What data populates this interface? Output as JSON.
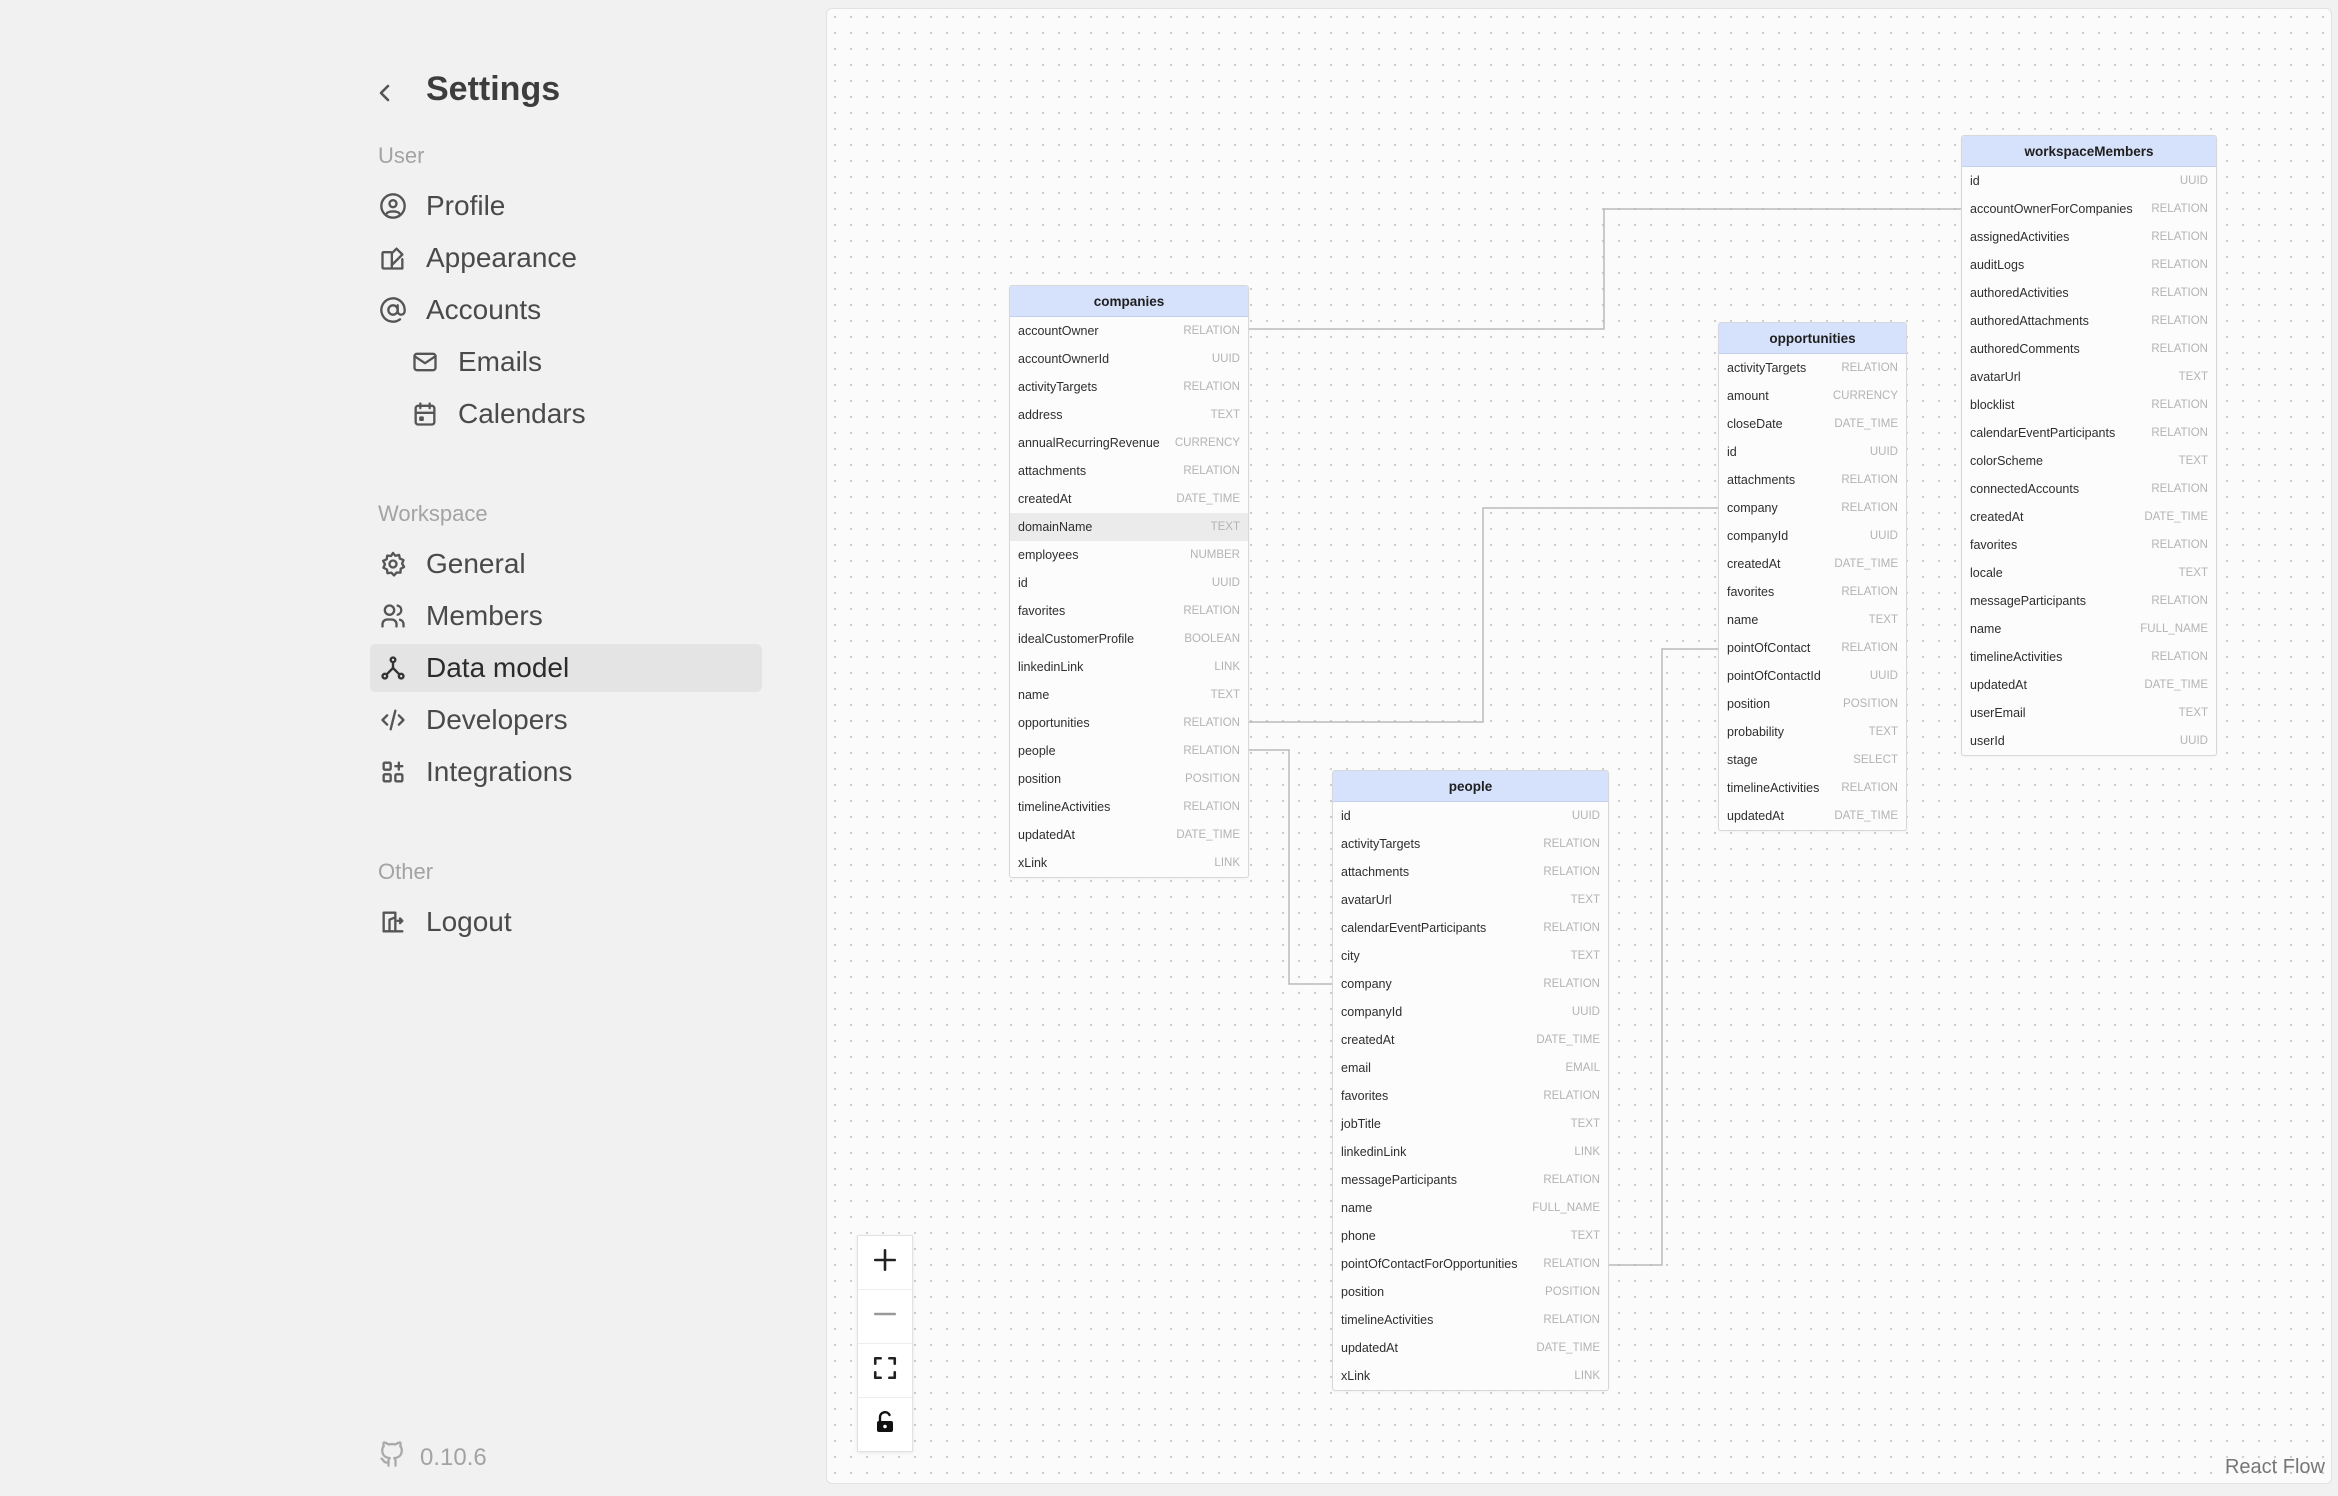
{
  "sidebar": {
    "title": "Settings",
    "sections": {
      "user": "User",
      "workspace": "Workspace",
      "other": "Other"
    },
    "items": {
      "profile": "Profile",
      "appearance": "Appearance",
      "accounts": "Accounts",
      "emails": "Emails",
      "calendars": "Calendars",
      "general": "General",
      "members": "Members",
      "data_model": "Data model",
      "developers": "Developers",
      "integrations": "Integrations",
      "logout": "Logout"
    },
    "active_item": "Data model",
    "version": "0.10.6"
  },
  "canvas": {
    "attribution": "React Flow",
    "tables": [
      {
        "name": "companies",
        "fields": [
          [
            "accountOwner",
            "RELATION"
          ],
          [
            "accountOwnerId",
            "UUID"
          ],
          [
            "activityTargets",
            "RELATION"
          ],
          [
            "address",
            "TEXT"
          ],
          [
            "annualRecurringRevenue",
            "CURRENCY"
          ],
          [
            "attachments",
            "RELATION"
          ],
          [
            "createdAt",
            "DATE_TIME"
          ],
          [
            "domainName",
            "TEXT"
          ],
          [
            "employees",
            "NUMBER"
          ],
          [
            "id",
            "UUID"
          ],
          [
            "favorites",
            "RELATION"
          ],
          [
            "idealCustomerProfile",
            "BOOLEAN"
          ],
          [
            "linkedinLink",
            "LINK"
          ],
          [
            "name",
            "TEXT"
          ],
          [
            "opportunities",
            "RELATION"
          ],
          [
            "people",
            "RELATION"
          ],
          [
            "position",
            "POSITION"
          ],
          [
            "timelineActivities",
            "RELATION"
          ],
          [
            "updatedAt",
            "DATE_TIME"
          ],
          [
            "xLink",
            "LINK"
          ]
        ],
        "highlighted_field": "domainName"
      },
      {
        "name": "people",
        "fields": [
          [
            "id",
            "UUID"
          ],
          [
            "activityTargets",
            "RELATION"
          ],
          [
            "attachments",
            "RELATION"
          ],
          [
            "avatarUrl",
            "TEXT"
          ],
          [
            "calendarEventParticipants",
            "RELATION"
          ],
          [
            "city",
            "TEXT"
          ],
          [
            "company",
            "RELATION"
          ],
          [
            "companyId",
            "UUID"
          ],
          [
            "createdAt",
            "DATE_TIME"
          ],
          [
            "email",
            "EMAIL"
          ],
          [
            "favorites",
            "RELATION"
          ],
          [
            "jobTitle",
            "TEXT"
          ],
          [
            "linkedinLink",
            "LINK"
          ],
          [
            "messageParticipants",
            "RELATION"
          ],
          [
            "name",
            "FULL_NAME"
          ],
          [
            "phone",
            "TEXT"
          ],
          [
            "pointOfContactForOpportunities",
            "RELATION"
          ],
          [
            "position",
            "POSITION"
          ],
          [
            "timelineActivities",
            "RELATION"
          ],
          [
            "updatedAt",
            "DATE_TIME"
          ],
          [
            "xLink",
            "LINK"
          ]
        ]
      },
      {
        "name": "opportunities",
        "fields": [
          [
            "activityTargets",
            "RELATION"
          ],
          [
            "amount",
            "CURRENCY"
          ],
          [
            "closeDate",
            "DATE_TIME"
          ],
          [
            "id",
            "UUID"
          ],
          [
            "attachments",
            "RELATION"
          ],
          [
            "company",
            "RELATION"
          ],
          [
            "companyId",
            "UUID"
          ],
          [
            "createdAt",
            "DATE_TIME"
          ],
          [
            "favorites",
            "RELATION"
          ],
          [
            "name",
            "TEXT"
          ],
          [
            "pointOfContact",
            "RELATION"
          ],
          [
            "pointOfContactId",
            "UUID"
          ],
          [
            "position",
            "POSITION"
          ],
          [
            "probability",
            "TEXT"
          ],
          [
            "stage",
            "SELECT"
          ],
          [
            "timelineActivities",
            "RELATION"
          ],
          [
            "updatedAt",
            "DATE_TIME"
          ]
        ]
      },
      {
        "name": "workspaceMembers",
        "fields": [
          [
            "id",
            "UUID"
          ],
          [
            "accountOwnerForCompanies",
            "RELATION"
          ],
          [
            "assignedActivities",
            "RELATION"
          ],
          [
            "auditLogs",
            "RELATION"
          ],
          [
            "authoredActivities",
            "RELATION"
          ],
          [
            "authoredAttachments",
            "RELATION"
          ],
          [
            "authoredComments",
            "RELATION"
          ],
          [
            "avatarUrl",
            "TEXT"
          ],
          [
            "blocklist",
            "RELATION"
          ],
          [
            "calendarEventParticipants",
            "RELATION"
          ],
          [
            "colorScheme",
            "TEXT"
          ],
          [
            "connectedAccounts",
            "RELATION"
          ],
          [
            "createdAt",
            "DATE_TIME"
          ],
          [
            "favorites",
            "RELATION"
          ],
          [
            "locale",
            "TEXT"
          ],
          [
            "messageParticipants",
            "RELATION"
          ],
          [
            "name",
            "FULL_NAME"
          ],
          [
            "timelineActivities",
            "RELATION"
          ],
          [
            "updatedAt",
            "DATE_TIME"
          ],
          [
            "userEmail",
            "TEXT"
          ],
          [
            "userId",
            "UUID"
          ]
        ]
      }
    ],
    "controls": {
      "zoom_in": "plus-icon",
      "zoom_out": "minus-icon",
      "fit_view": "fit-view-icon",
      "lock": "lock-icon"
    }
  }
}
